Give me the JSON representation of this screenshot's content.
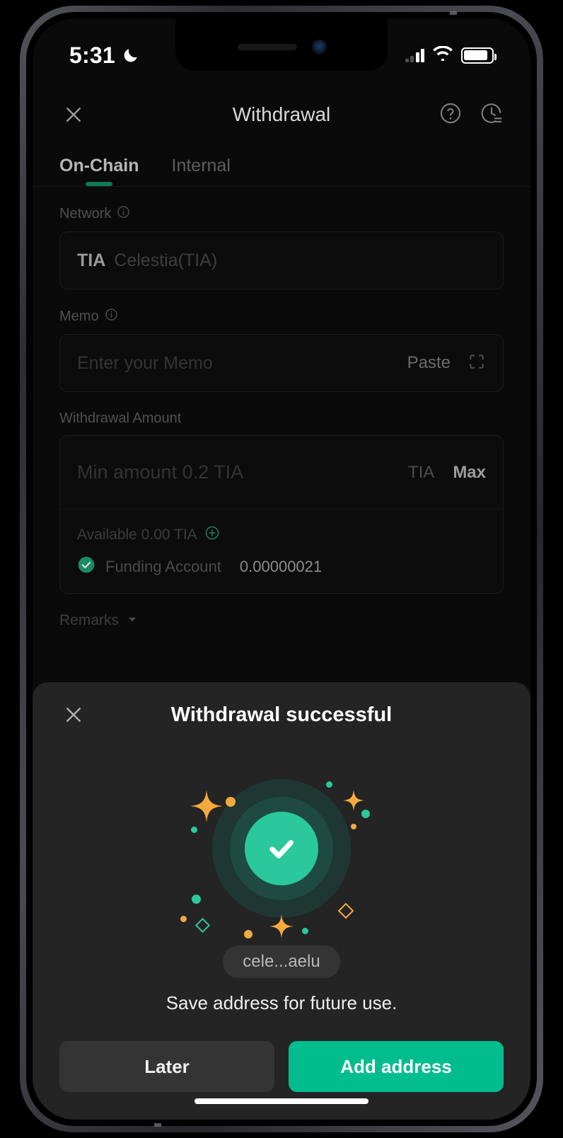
{
  "status_bar": {
    "time": "5:31",
    "dnd_icon": "moon-icon",
    "signal_icon": "cellular-signal-icon",
    "wifi_icon": "wifi-icon",
    "battery_icon": "battery-icon"
  },
  "header": {
    "close_icon": "close-icon",
    "title": "Withdrawal",
    "help_icon": "help-circle-icon",
    "history_icon": "history-clock-icon"
  },
  "tabs": [
    {
      "label": "On-Chain",
      "active": true
    },
    {
      "label": "Internal",
      "active": false
    }
  ],
  "network": {
    "label": "Network",
    "info_icon": "info-circle-icon",
    "symbol": "TIA",
    "name": "Celestia(TIA)"
  },
  "memo": {
    "label": "Memo",
    "info_icon": "info-circle-icon",
    "placeholder": "Enter your Memo",
    "paste_label": "Paste",
    "scan_icon": "scan-qr-icon"
  },
  "amount": {
    "label": "Withdrawal Amount",
    "placeholder": "Min amount 0.2 TIA",
    "unit": "TIA",
    "max_label": "Max",
    "available_text": "Available 0.00 TIA",
    "add_icon": "plus-circle-icon",
    "funding_check_icon": "check-circle-icon",
    "funding_label": "Funding Account",
    "funding_amount": "0.00000021"
  },
  "remarks": {
    "label": "Remarks",
    "chevron_icon": "chevron-down-icon"
  },
  "modal": {
    "close_icon": "close-icon",
    "title": "Withdrawal successful",
    "success_icon": "check-circle-success-icon",
    "address_chip": "cele...aelu",
    "save_text": "Save address for future use.",
    "later_label": "Later",
    "add_address_label": "Add address"
  },
  "colors": {
    "accent_green": "#01bd8d",
    "success_green": "#2ac89a",
    "tab_underline_green": "#0d7a58",
    "spark_orange": "#f5a93f",
    "modal_bg": "#242424",
    "page_bg": "#0a0a0a"
  },
  "home_indicator": "home-indicator"
}
